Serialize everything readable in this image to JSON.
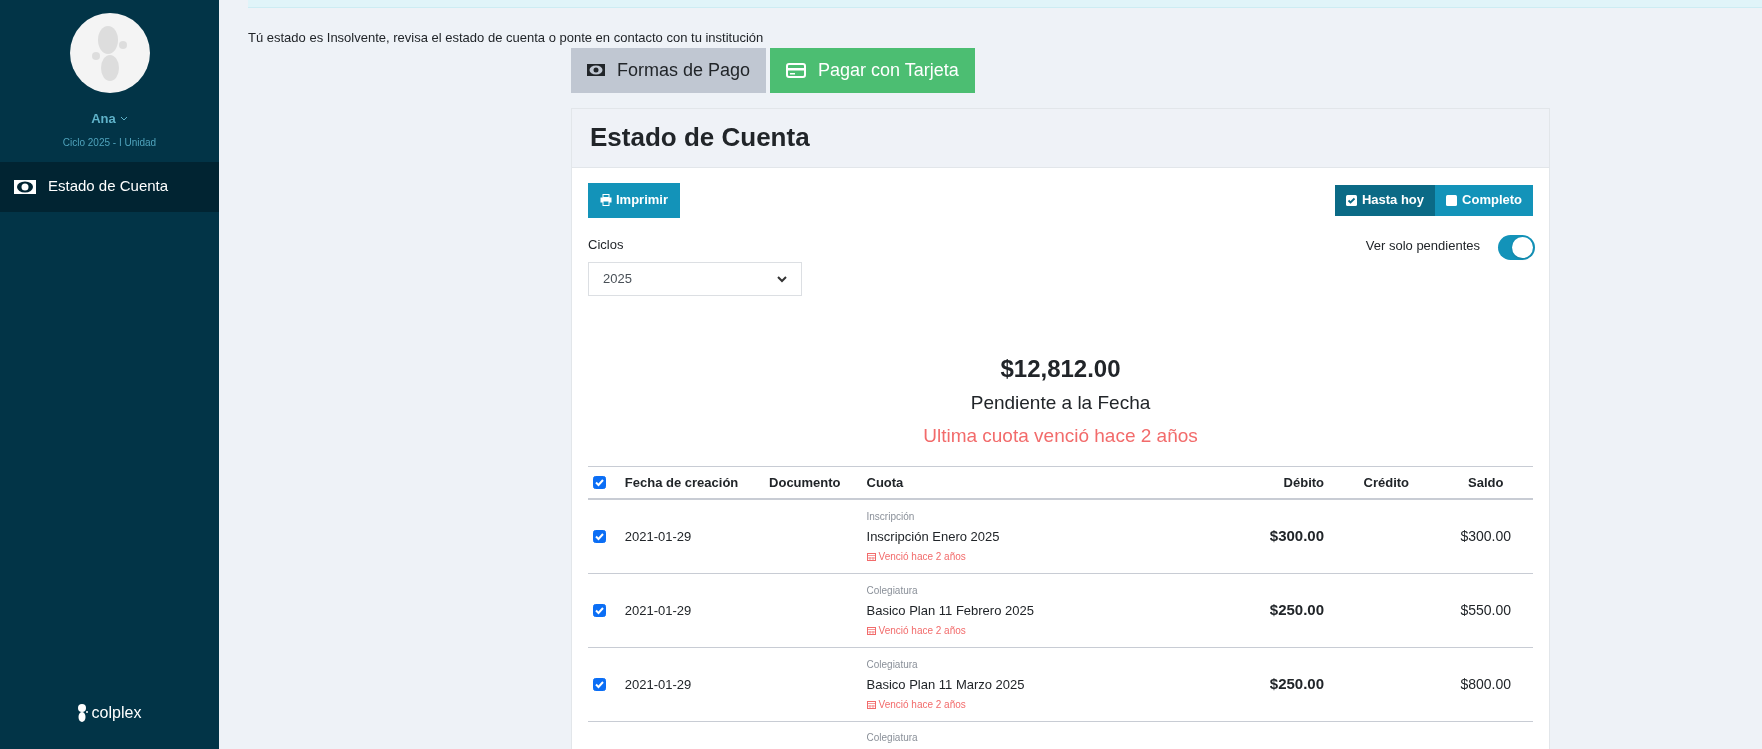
{
  "sidebar": {
    "user": {
      "name": "Ana",
      "subtitle": "Ciclo 2025 - I Unidad"
    },
    "items": [
      {
        "label": "Estado de Cuenta",
        "selected": true
      }
    ],
    "logo": "colplex"
  },
  "notice": "Tú estado es Insolvente, revisa el estado de cuenta o ponte en contacto con tu institución",
  "actions": [
    {
      "label": "Formas de Pago",
      "kind": "cash"
    },
    {
      "label": "Pagar con Tarjeta",
      "kind": "card"
    }
  ],
  "card": {
    "title": "Estado de Cuenta",
    "print_button": "Imprimir",
    "range": [
      {
        "label": "Hasta hoy",
        "selected": true
      },
      {
        "label": "Completo",
        "selected": false
      }
    ],
    "cycles": {
      "label": "Ciclos",
      "value": "2025"
    },
    "pending_only": {
      "label": "Ver solo pendientes",
      "on": true
    },
    "summary": {
      "amount": "$12,812.00",
      "caption": "Pendiente a la Fecha",
      "warning": "Ultima cuota venció hace 2 años"
    },
    "table": {
      "select_all": true,
      "columns": [
        "Fecha de creación",
        "Documento",
        "Cuota",
        "Débito",
        "Crédito",
        "Saldo"
      ],
      "rows": [
        {
          "checked": true,
          "date": "2021-01-29",
          "category": "Inscripción",
          "concept": "Inscripción Enero 2025",
          "due": "Venció hace 2 años",
          "debit": "$300.00",
          "balance": "$300.00"
        },
        {
          "checked": true,
          "date": "2021-01-29",
          "category": "Colegiatura",
          "concept": "Basico Plan 11 Febrero 2025",
          "due": "Venció hace 2 años",
          "debit": "$250.00",
          "balance": "$550.00"
        },
        {
          "checked": true,
          "date": "2021-01-29",
          "category": "Colegiatura",
          "concept": "Basico Plan 11 Marzo 2025",
          "due": "Venció hace 2 años",
          "debit": "$250.00",
          "balance": "$800.00"
        },
        {
          "category": "Colegiatura"
        }
      ]
    }
  }
}
